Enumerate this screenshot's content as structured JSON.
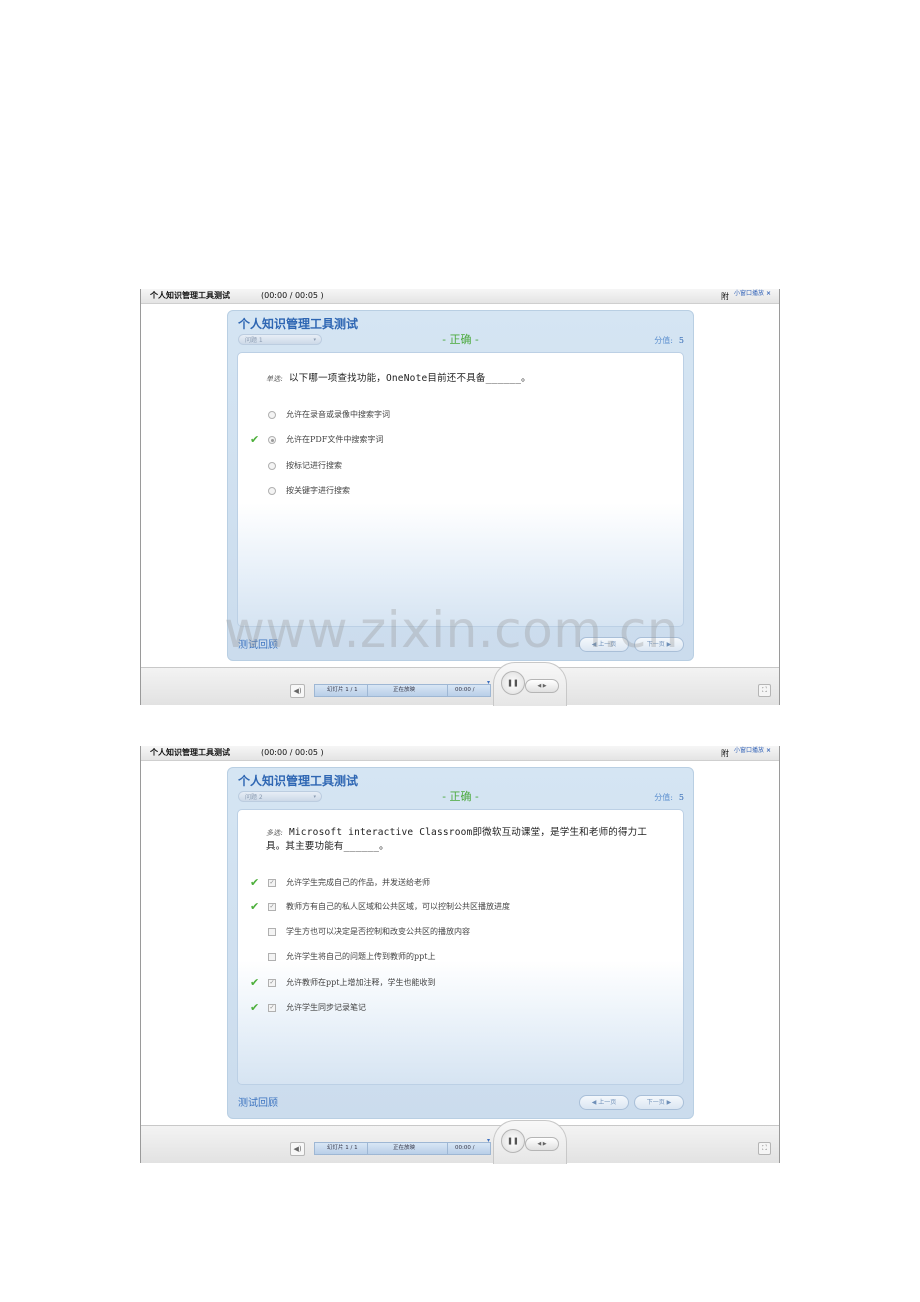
{
  "players": [
    {
      "titlebar": {
        "title": "个人知识管理工具测试",
        "time": "(00:00 / 00:05 )",
        "attach": "附",
        "mini": "小窗口播放",
        "close": "×"
      },
      "quiz": {
        "title": "个人知识管理工具测试",
        "question_select": "问题 1",
        "result": "- 正确 -",
        "score_label": "分值:",
        "score_value": "5",
        "question_type": "单选:",
        "question_text": "以下哪一项查找功能，OneNote目前还不具备______。",
        "options": [
          {
            "label": "允许在录音或录像中搜索字词",
            "checked": false,
            "correct": false
          },
          {
            "label": "允许在PDF文件中搜索字词",
            "checked": true,
            "correct": true
          },
          {
            "label": "按标记进行搜索",
            "checked": false,
            "correct": false
          },
          {
            "label": "按关键字进行搜索",
            "checked": false,
            "correct": false
          }
        ],
        "review": "测试回顾",
        "prev": "◀ 上一页",
        "next": "下一页 ▶"
      },
      "controls": {
        "slide": "幻灯片 1 / 1",
        "status": "正在放映",
        "time": "00:00 /"
      }
    },
    {
      "titlebar": {
        "title": "个人知识管理工具测试",
        "time": "(00:00 / 00:05 )",
        "attach": "附",
        "mini": "小窗口播放",
        "close": "×"
      },
      "quiz": {
        "title": "个人知识管理工具测试",
        "question_select": "问题 2",
        "result": "- 正确 -",
        "score_label": "分值:",
        "score_value": "5",
        "question_type": "多选:",
        "question_text": "Microsoft interactive Classroom即微软互动课堂，是学生和老师的得力工具。其主要功能有______。",
        "options": [
          {
            "label": "允许学生完成自己的作品，并发送给老师",
            "checked": true,
            "correct": true
          },
          {
            "label": "教师方有自己的私人区域和公共区域，可以控制公共区播放进度",
            "checked": true,
            "correct": true
          },
          {
            "label": "学生方也可以决定是否控制和改变公共区的播放内容",
            "checked": false,
            "correct": false
          },
          {
            "label": "允许学生将自己的问题上传到教师的ppt上",
            "checked": false,
            "correct": false
          },
          {
            "label": "允许教师在ppt上增加注释，学生也能收到",
            "checked": true,
            "correct": true
          },
          {
            "label": "允许学生同步记录笔记",
            "checked": true,
            "correct": true
          }
        ],
        "review": "测试回顾",
        "prev": "◀ 上一页",
        "next": "下一页 ▶"
      },
      "controls": {
        "slide": "幻灯片 1 / 1",
        "status": "正在放映",
        "time": "00:00 /"
      }
    }
  ],
  "watermark": "www.zixin.com.cn",
  "colors": {
    "accent": "#2e66b3",
    "correct": "#4aa93b",
    "panel": "#d5e5f3"
  },
  "icons": {
    "check": "checkmark-icon",
    "pause": "pause-icon",
    "volume": "volume-icon",
    "fullscreen": "fullscreen-icon"
  }
}
